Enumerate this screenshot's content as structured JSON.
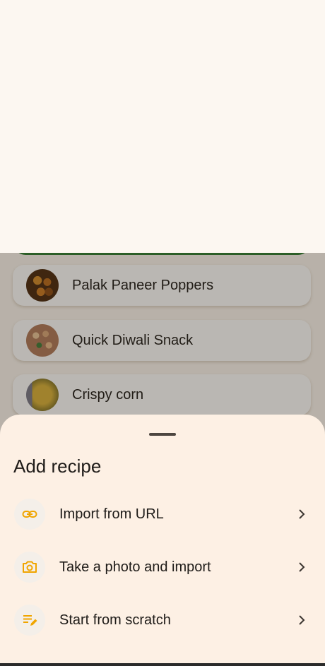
{
  "recipes": [
    {
      "name": "Palak Paneer Poppers"
    },
    {
      "name": "Quick Diwali Snack"
    },
    {
      "name": "Crispy corn"
    }
  ],
  "sheet": {
    "title": "Add recipe",
    "options": [
      {
        "label": "Import from URL",
        "icon": "link-icon"
      },
      {
        "label": "Take a photo and import",
        "icon": "camera-icon"
      },
      {
        "label": "Start from scratch",
        "icon": "edit-note-icon"
      }
    ]
  },
  "colors": {
    "accent": "#f0a500",
    "sheet_bg": "#fdf0e4",
    "page_bg": "#fcf7f1",
    "selected_border": "#2e7d32"
  }
}
